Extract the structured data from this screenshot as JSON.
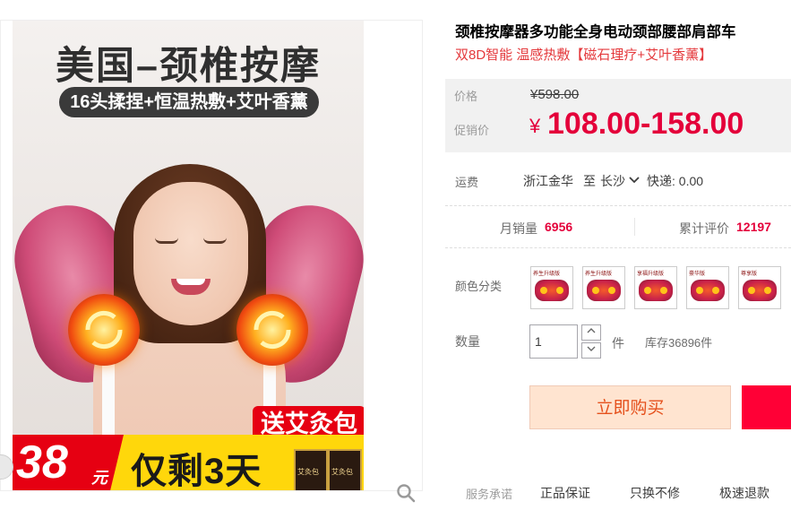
{
  "product_image": {
    "headline": "美国–颈椎按摩",
    "subline": "16头揉捏+恒温热敷+艾叶香薰",
    "gift_tag": "送艾灸包",
    "badge_price": "38",
    "badge_unit": "元",
    "countdown": "仅剩3天",
    "gift_box_label": "艾灸包"
  },
  "product": {
    "title": "颈椎按摩器多功能全身电动颈部腰部肩部车",
    "subtitle": "双8D智能 温感热敷【磁石理疗+艾叶香薰】"
  },
  "price": {
    "label": "价格",
    "original": "¥598.00",
    "promo_label": "促销价",
    "currency": "¥",
    "promo": "108.00-158.00"
  },
  "shipping": {
    "label": "运费",
    "from": "浙江金华",
    "to_label": "至",
    "to": "长沙",
    "method": "快递: 0.00"
  },
  "stats": {
    "monthly_sales_label": "月销量",
    "monthly_sales": "6956",
    "reviews_label": "累计评价",
    "reviews": "12197"
  },
  "options": {
    "color_label": "颜色分类",
    "swatches": [
      "养生升级版",
      "养生升级版",
      "享福升级版",
      "豪华版",
      "尊享版"
    ]
  },
  "quantity": {
    "label": "数量",
    "value": "1",
    "unit": "件",
    "stock": "库存36896件"
  },
  "actions": {
    "buy_now": "立即购买"
  },
  "services": {
    "label": "服务承诺",
    "items": [
      "正品保证",
      "只换不修",
      "极速退款"
    ]
  },
  "colors": {
    "accent": "#e4003a",
    "buy_bg": "#ffe4d0",
    "cart_bg": "#ff0036",
    "price_bg": "#f1f1f1"
  }
}
